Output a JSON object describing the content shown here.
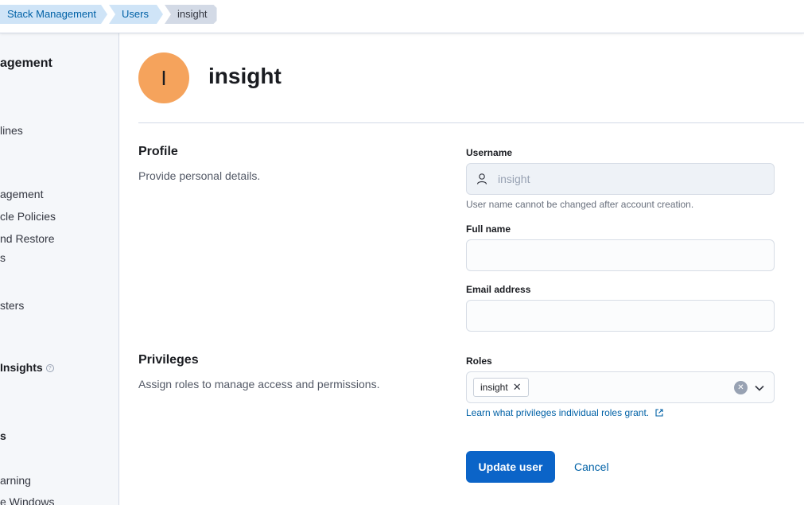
{
  "breadcrumbs": [
    "Stack Management",
    "Users",
    "insight"
  ],
  "sidebar": {
    "title": "agement",
    "items": [
      {
        "label": "lines"
      },
      {
        "label": "agement"
      },
      {
        "label": "cle Policies"
      },
      {
        "label": "nd Restore"
      },
      {
        "label": "s"
      },
      {
        "label": "sters"
      },
      {
        "label": "Insights"
      },
      {
        "label": "s"
      },
      {
        "label": "arning"
      },
      {
        "label": "e Windows"
      }
    ]
  },
  "user": {
    "avatar_initial": "I",
    "name": "insight"
  },
  "profile": {
    "title": "Profile",
    "description": "Provide personal details.",
    "username_label": "Username",
    "username_value": "insight",
    "username_help": "User name cannot be changed after account creation.",
    "fullname_label": "Full name",
    "fullname_value": "",
    "email_label": "Email address",
    "email_value": ""
  },
  "privileges": {
    "title": "Privileges",
    "description": "Assign roles to manage access and permissions.",
    "roles_label": "Roles",
    "roles": [
      "insight"
    ],
    "learn_link": "Learn what privileges individual roles grant."
  },
  "actions": {
    "update_label": "Update user",
    "cancel_label": "Cancel"
  },
  "colors": {
    "primary": "#0b64c8",
    "avatar": "#f5a35c",
    "link": "#0061a6"
  }
}
